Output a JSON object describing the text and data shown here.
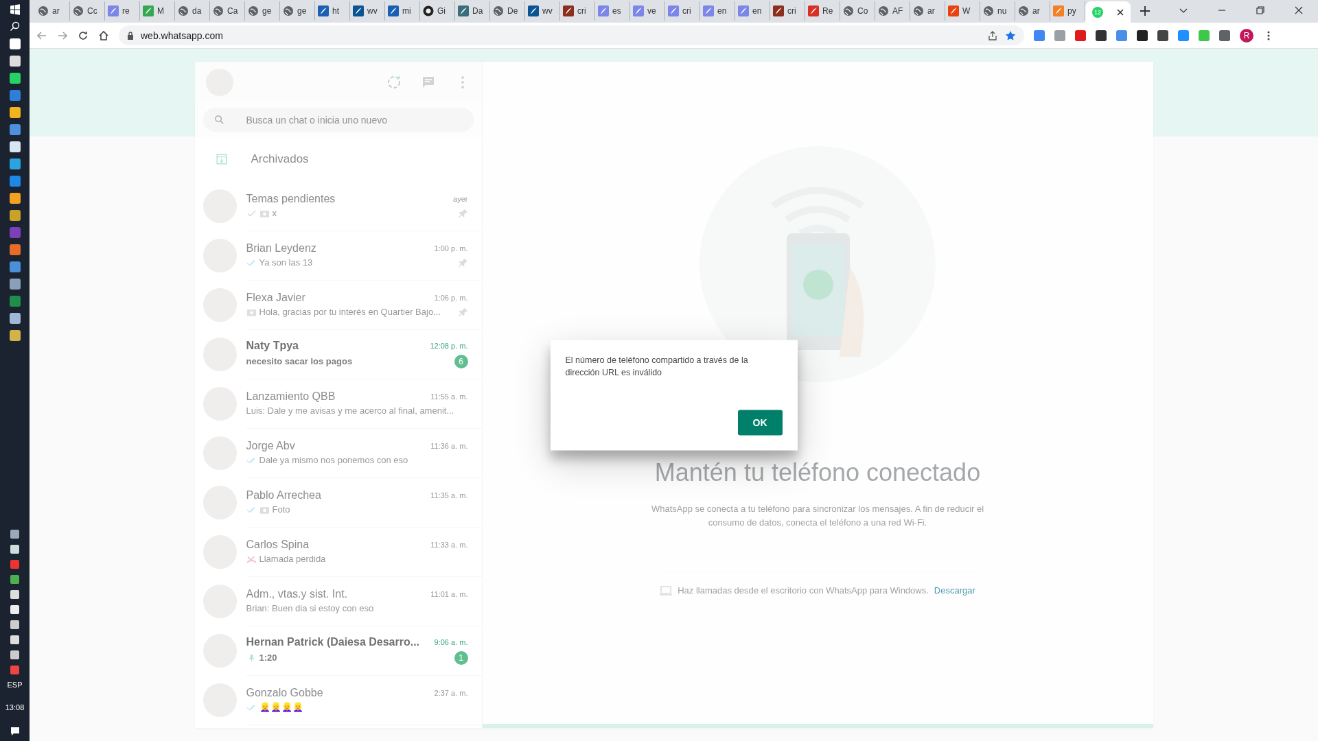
{
  "taskbar": {
    "language": "ESP",
    "time": "13:08"
  },
  "browser": {
    "tabs": [
      {
        "kind": "globe",
        "label": "ar",
        "selected": false
      },
      {
        "kind": "globe",
        "label": "Cc",
        "selected": false
      },
      {
        "kind": "feather",
        "label": "re",
        "selected": false
      },
      {
        "kind": "meet",
        "label": "M",
        "selected": false
      },
      {
        "kind": "globe",
        "label": "da",
        "selected": false
      },
      {
        "kind": "globe",
        "label": "Ca",
        "selected": false
      },
      {
        "kind": "globe",
        "label": "ge",
        "selected": false
      },
      {
        "kind": "globe",
        "label": "ge",
        "selected": false
      },
      {
        "kind": "feather-dark",
        "label": "ht",
        "selected": false
      },
      {
        "kind": "ln",
        "label": "wv",
        "selected": false
      },
      {
        "kind": "feather-dark",
        "label": "mi",
        "selected": false
      },
      {
        "kind": "github",
        "label": "Gi",
        "selected": false
      },
      {
        "kind": "app",
        "label": "Da",
        "selected": false
      },
      {
        "kind": "globe",
        "label": "De",
        "selected": false
      },
      {
        "kind": "ln",
        "label": "wv",
        "selected": false
      },
      {
        "kind": "feather-red",
        "label": "cri",
        "selected": false
      },
      {
        "kind": "feather",
        "label": "es",
        "selected": false
      },
      {
        "kind": "feather",
        "label": "ve",
        "selected": false
      },
      {
        "kind": "feather",
        "label": "cri",
        "selected": false
      },
      {
        "kind": "feather",
        "label": "en",
        "selected": false
      },
      {
        "kind": "feather",
        "label": "en",
        "selected": false
      },
      {
        "kind": "feather-red",
        "label": "cri",
        "selected": false
      },
      {
        "kind": "gmail",
        "label": "Re",
        "selected": false
      },
      {
        "kind": "globe",
        "label": "Co",
        "selected": false
      },
      {
        "kind": "globe",
        "label": "AF",
        "selected": false
      },
      {
        "kind": "globe",
        "label": "ar",
        "selected": false
      },
      {
        "kind": "alert",
        "label": "W",
        "selected": false
      },
      {
        "kind": "globe",
        "label": "nu",
        "selected": false
      },
      {
        "kind": "globe",
        "label": "ar",
        "selected": false
      },
      {
        "kind": "stack",
        "label": "py",
        "selected": false
      },
      {
        "kind": "whatsapp",
        "badge": "12",
        "selected": true
      }
    ],
    "url": "web.whatsapp.com",
    "profile_initial": "R"
  },
  "sidebar": {
    "search": {
      "placeholder": "Busca un chat o inicia uno nuevo"
    },
    "archived": "Archivados",
    "chats": [
      {
        "name": "Temas pendientes",
        "time": "ayer",
        "kind": "sent",
        "photo": true,
        "preview": "x",
        "pinned": true,
        "unread": false
      },
      {
        "name": "Brian Leydenz",
        "time": "1:00 p. m.",
        "kind": "read",
        "photo": false,
        "preview": "Ya son las 13",
        "pinned": true,
        "unread": false
      },
      {
        "name": "Flexa Javier",
        "time": "1:06 p. m.",
        "kind": "text",
        "photo": true,
        "preview": "Hola, gracias por tu interés en Quartier Bajo...",
        "pinned": true,
        "unread": false
      },
      {
        "name": "Naty Tpya",
        "time": "12:08 p. m.",
        "kind": "text",
        "photo": false,
        "preview": "necesito sacar los pagos",
        "pinned": false,
        "unread": true,
        "count": "6"
      },
      {
        "name": "Lanzamiento QBB",
        "time": "11:55 a. m.",
        "kind": "text",
        "photo": false,
        "preview": "Luis: Dale y me avisas y me acerco al final, amenit...",
        "pinned": false,
        "unread": false
      },
      {
        "name": "Jorge Abv",
        "time": "11:36 a. m.",
        "kind": "read",
        "photo": false,
        "preview": "Dale ya mismo nos ponemos con eso",
        "pinned": false,
        "unread": false
      },
      {
        "name": "Pablo Arrechea",
        "time": "11:35 a. m.",
        "kind": "read",
        "photo": true,
        "preview": "Foto",
        "pinned": false,
        "unread": false
      },
      {
        "name": "Carlos Spina",
        "time": "11:33 a. m.",
        "kind": "missed-call",
        "photo": false,
        "preview": "Llamada perdida",
        "pinned": false,
        "unread": false
      },
      {
        "name": "Adm., vtas.y sist. Int.",
        "time": "11:01 a. m.",
        "kind": "text",
        "photo": false,
        "preview": "Brian: Buen dia si estoy con eso",
        "pinned": false,
        "unread": false
      },
      {
        "name": "Hernan Patrick (Daiesa Desarro...",
        "time": "9:06 a. m.",
        "kind": "voice",
        "photo": false,
        "preview": "1:20",
        "pinned": false,
        "unread": true,
        "count": "1"
      },
      {
        "name": "Gonzalo Gobbe",
        "time": "2:37 a. m.",
        "kind": "read",
        "photo": false,
        "preview": "👱‍♀️👱‍♀️👱‍♀️👱‍♀️",
        "pinned": false,
        "unread": false
      }
    ]
  },
  "intro": {
    "title": "Mantén tu teléfono conectado",
    "text": "WhatsApp se conecta a tu teléfono para sincronizar los mensajes. A fin de reducir el consumo de datos, conecta el teléfono a una red Wi-Fi.",
    "footer": "Haz llamadas desde el escritorio con WhatsApp para Windows.",
    "footer_link": "Descargar"
  },
  "dialog": {
    "message": "El número de teléfono compartido a través de la dirección URL es inválido",
    "button": "OK"
  }
}
